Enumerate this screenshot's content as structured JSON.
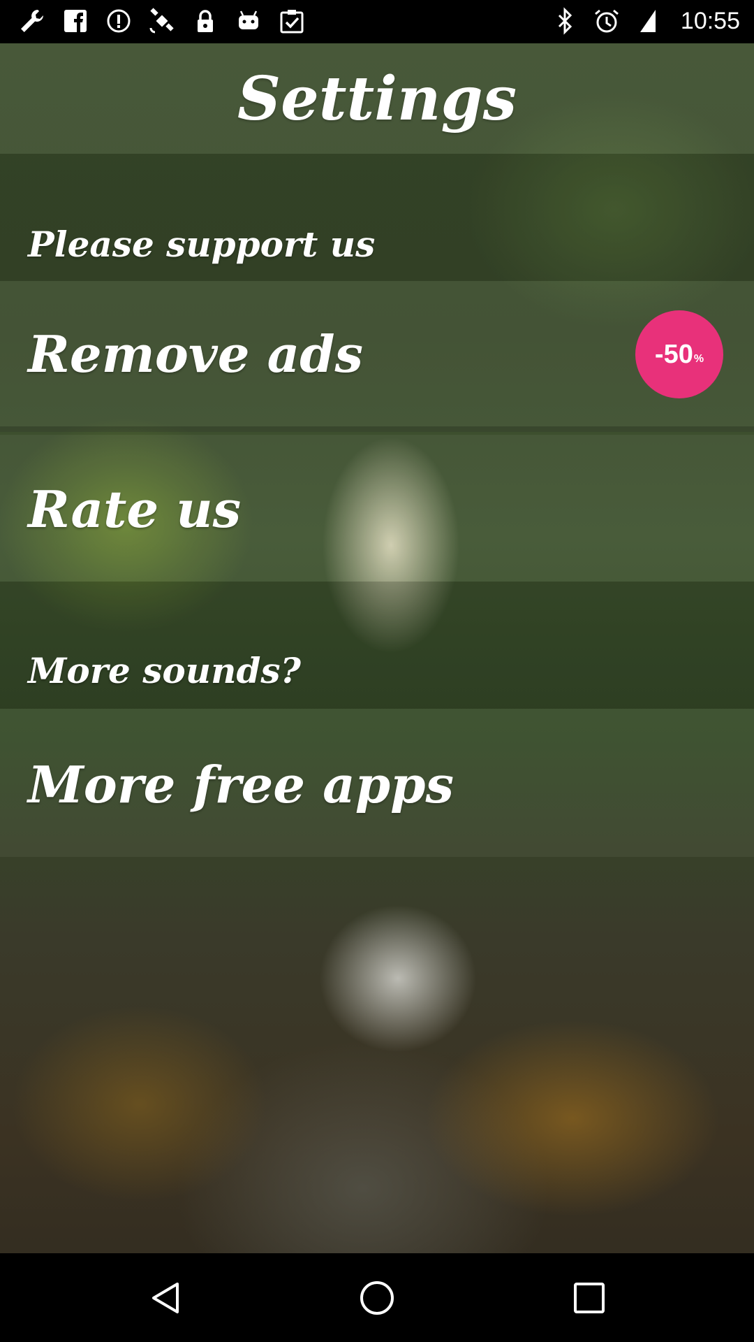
{
  "status_bar": {
    "time": "10:55",
    "left_icons": [
      "wrench-icon",
      "facebook-icon",
      "info-icon",
      "satellite-icon",
      "lock-icon",
      "android-icon",
      "clipboard-check-icon"
    ],
    "right_icons": [
      "bluetooth-icon",
      "alarm-icon",
      "signal-icon"
    ]
  },
  "header": {
    "title": "Settings"
  },
  "menu": {
    "support_label": "Please support us",
    "remove_ads_label": "Remove ads",
    "discount_badge": {
      "value": "-50",
      "unit": "%",
      "color": "#e8317a"
    },
    "rate_label": "Rate us",
    "more_sounds_label": "More sounds?",
    "more_apps_label": "More free apps"
  },
  "nav_bar": {
    "buttons": [
      "back-icon",
      "home-icon",
      "recents-icon"
    ]
  }
}
